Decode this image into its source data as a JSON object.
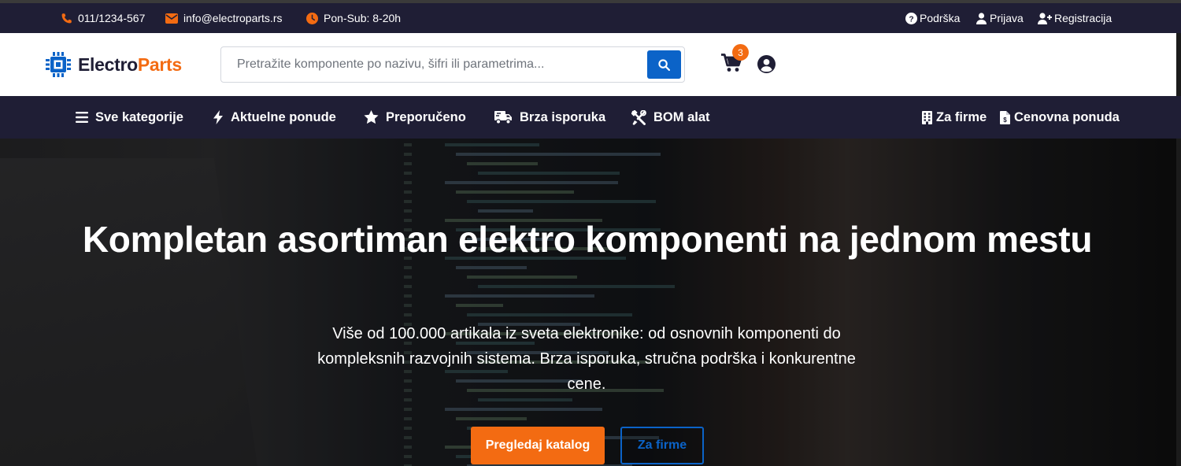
{
  "topbar": {
    "phone": "011/1234-567",
    "email": "info@electroparts.rs",
    "hours": "Pon-Sub: 8-20h",
    "support": "Podrška",
    "login": "Prijava",
    "register": "Registracija"
  },
  "header": {
    "logo_part1": "Electro",
    "logo_part2": "Parts",
    "search_placeholder": "Pretražite komponente po nazivu, šifri ili parametrima...",
    "cart_count": "3"
  },
  "nav": {
    "all_categories": "Sve kategorije",
    "current_offers": "Aktuelne ponude",
    "recommended": "Preporučeno",
    "fast_delivery": "Brza isporuka",
    "bom_tool": "BOM alat",
    "for_companies": "Za firme",
    "price_quote": "Cenovna ponuda"
  },
  "hero": {
    "title": "Kompletan asortiman elektro komponenti na jednom mestu",
    "subtitle": "Više od 100.000 artikala iz sveta elektronike: od osnovnih komponenti do kompleksnih razvojnih sistema. Brza isporuka, stručna podrška i konkurentne cene.",
    "primary_button": "Pregledaj katalog",
    "secondary_button": "Za firme"
  },
  "colors": {
    "dark_navy": "#1f1e35",
    "accent_orange": "#f36b12",
    "primary_blue": "#0b63c8"
  },
  "icons": [
    "phone-icon",
    "email-icon",
    "clock-icon",
    "question-circle-icon",
    "user-icon",
    "user-plus-icon",
    "chip-logo-icon",
    "search-icon",
    "cart-icon",
    "user-circle-icon",
    "bars-icon",
    "bolt-icon",
    "star-icon",
    "truck-icon",
    "tools-icon",
    "building-icon",
    "invoice-icon"
  ]
}
